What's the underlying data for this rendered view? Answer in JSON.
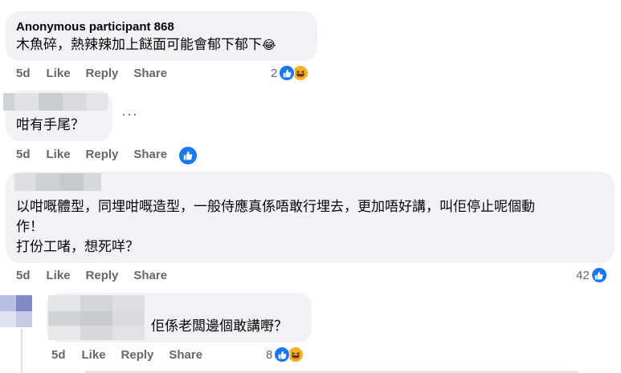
{
  "comments": [
    {
      "author": "Anonymous participant 868",
      "text": "木魚碎，熱辣辣加上餸面可能會郁下郁下",
      "emoji": "😂",
      "time": "5d",
      "like": "Like",
      "reply": "Reply",
      "share": "Share",
      "reaction_count": "2",
      "reactions": [
        "like-icon",
        "haha-icon"
      ]
    },
    {
      "author": "",
      "text": "咁有手尾？",
      "more": "···",
      "time": "5d",
      "like": "Like",
      "reply": "Reply",
      "share": "Share",
      "reactions": [
        "like-icon"
      ]
    },
    {
      "author": "",
      "text_lines": [
        "以咁嘅體型，同埋咁嘅造型，一般侍應真係唔敢行埋去，更加唔好講，叫佢停止呢個動",
        "作！",
        "打份工啫，想死咩？"
      ],
      "time": "5d",
      "like": "Like",
      "reply": "Reply",
      "share": "Share",
      "reaction_count": "42",
      "reactions": [
        "like-icon"
      ]
    },
    {
      "author": "",
      "text": "佢係老闆邊個敢講嘢？",
      "time": "5d",
      "like": "Like",
      "reply": "Reply",
      "share": "Share",
      "reaction_count": "8",
      "reactions": [
        "like-icon",
        "haha-icon"
      ]
    }
  ],
  "colors": {
    "bubble": "#f0f2f5",
    "meta": "#65676b",
    "like": "#1877f2",
    "haha": "#f7b125"
  }
}
